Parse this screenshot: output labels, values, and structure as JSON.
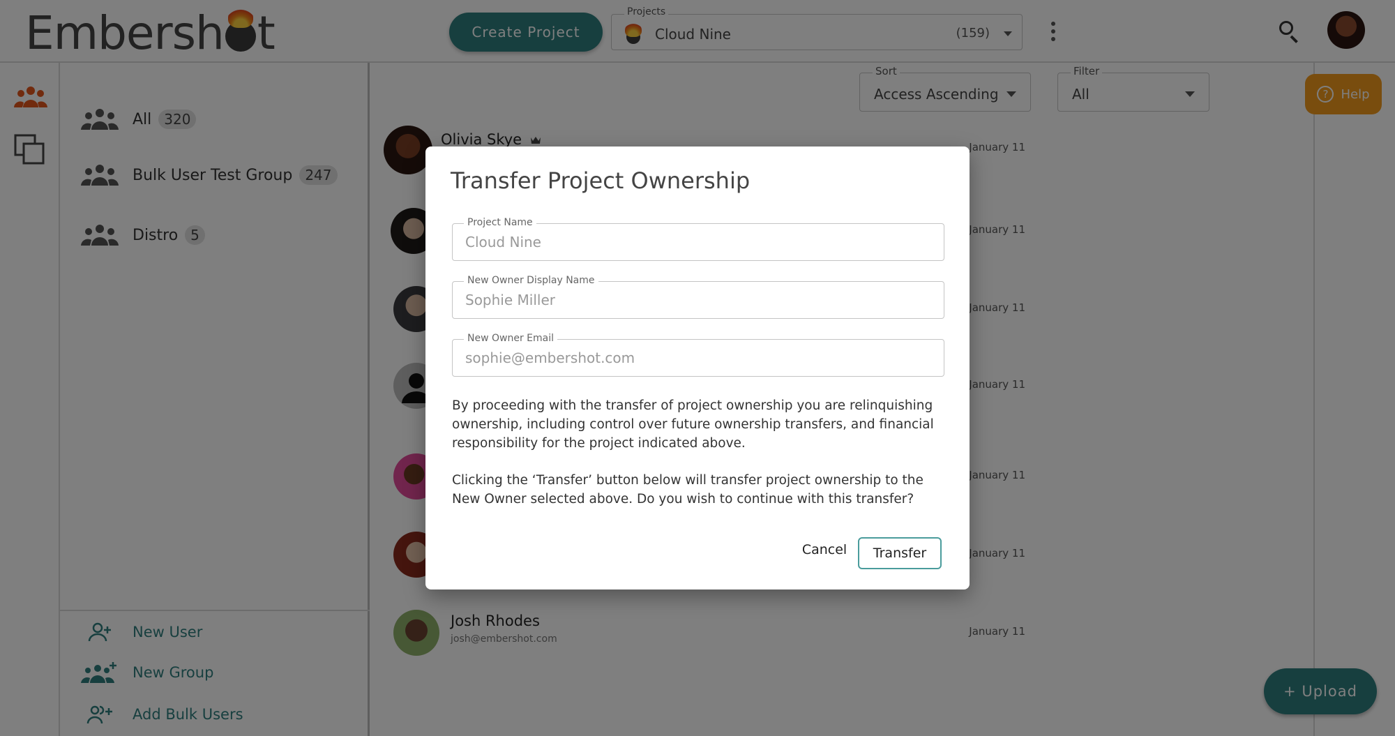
{
  "app": {
    "logo_text_a": "Embersh",
    "logo_text_b": "t"
  },
  "header": {
    "create_label": "Create Project",
    "projects_label": "Projects",
    "project_name": "Cloud Nine",
    "project_count": "(159)"
  },
  "groups": {
    "items": [
      {
        "label": "All",
        "count": "320"
      },
      {
        "label": "Bulk User Test Group",
        "count": "247"
      },
      {
        "label": "Distro",
        "count": "5"
      }
    ],
    "actions": [
      {
        "label": "New User",
        "icon": "add-user-icon"
      },
      {
        "label": "New Group",
        "icon": "add-group-icon"
      },
      {
        "label": "Add Bulk Users",
        "icon": "add-bulk-users-icon"
      }
    ]
  },
  "toolbar": {
    "sort_label": "Sort",
    "sort_value": "Access Ascending",
    "filter_label": "Filter",
    "filter_value": "All",
    "help_label": "Help"
  },
  "users": [
    {
      "name": "Olivia Skye",
      "email": "",
      "date": "January 11",
      "owner": true
    },
    {
      "name": "",
      "email": "",
      "date": "January 11"
    },
    {
      "name": "",
      "email": "",
      "date": "January 11"
    },
    {
      "name": "",
      "email": "",
      "date": "January 11"
    },
    {
      "name": "",
      "email": "",
      "date": "January 11"
    },
    {
      "name": "",
      "email": "",
      "date": "January 11"
    },
    {
      "name": "Josh Rhodes",
      "email": "josh@embershot.com",
      "date": "January 11"
    }
  ],
  "upload_label": "+ Upload",
  "dialog": {
    "title": "Transfer Project Ownership",
    "project_name_label": "Project Name",
    "project_name_value": "Cloud Nine",
    "owner_name_label": "New Owner Display Name",
    "owner_name_value": "Sophie Miller",
    "owner_email_label": "New Owner Email",
    "owner_email_value": "sophie@embershot.com",
    "paragraph1": "By proceeding with the transfer of project ownership you are relinquishing ownership, including control over future ownership transfers, and financial responsibility for the project indicated above.",
    "paragraph2": "Clicking the ‘Transfer’ button below will transfer project ownership to the New Owner selected above. Do you wish to continue with this transfer?",
    "cancel_label": "Cancel",
    "transfer_label": "Transfer"
  },
  "colors": {
    "accent": "#2e7e7e",
    "help": "#f29a1c",
    "rail_active": "#e2561c"
  }
}
